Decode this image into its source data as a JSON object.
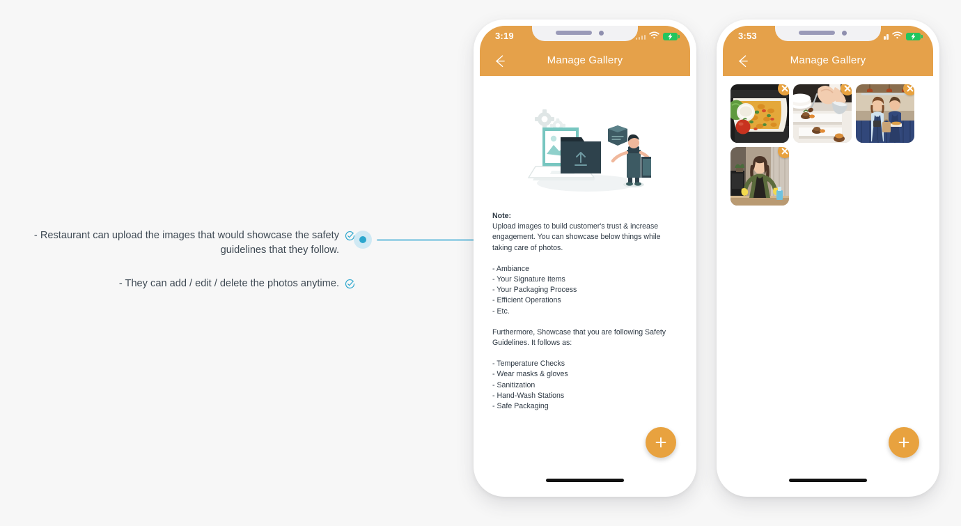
{
  "page": {
    "background_color": "#f7f7f7"
  },
  "annotations": {
    "items": [
      {
        "text": "- Restaurant can upload the images that would showcase the safety\nguidelines that they follow.",
        "icon": "check-circle-icon"
      },
      {
        "text": "- They can add / edit / delete the photos anytime.",
        "icon": "check-circle-icon"
      }
    ],
    "connector": {
      "dot_color": "#2ba6cd",
      "halo_color": "#cfe9f4",
      "line_color": "#9ed3e6"
    },
    "text_color": "#3f4a54",
    "check_color": "#2ba6cd"
  },
  "theme": {
    "accent": "#e5a14a",
    "fab": "#e8a23f",
    "battery": "#22c55e",
    "screen_bg": "#ffffff"
  },
  "phone1": {
    "status": {
      "time": "3:19",
      "signal_icon": "signal-dots-icon",
      "wifi_icon": "wifi-icon",
      "battery_icon": "battery-charging-icon"
    },
    "appbar": {
      "back_icon": "back-arrow-icon",
      "title": "Manage Gallery"
    },
    "illustration": {
      "name": "upload-files-illustration"
    },
    "note": {
      "title": "Note:",
      "paragraph": "Upload images to build customer's trust & increase engagement. You can showcase below things while taking care of photos.",
      "list": [
        "- Ambiance",
        "- Your Signature Items",
        "- Your Packaging Process",
        "- Efficient Operations",
        "- Etc."
      ],
      "paragraph2": "Furthermore, Showcase that you are following Safety Guidelines. It follows as:",
      "list2": [
        "- Temperature Checks",
        "- Wear masks & gloves",
        "- Sanitization",
        "- Hand-Wash Stations",
        "- Safe Packaging"
      ]
    },
    "fab": {
      "icon": "plus-icon",
      "label": "+"
    }
  },
  "phone2": {
    "status": {
      "time": "3:53",
      "signal_icon": "signal-bars-icon",
      "wifi_icon": "wifi-icon",
      "battery_icon": "battery-charging-icon"
    },
    "appbar": {
      "back_icon": "back-arrow-icon",
      "title": "Manage Gallery"
    },
    "gallery": {
      "items": [
        {
          "name": "thumbnail-takeout-pasta-box",
          "delete_icon": "delete-circle-icon"
        },
        {
          "name": "thumbnail-chef-plating-dish",
          "delete_icon": "delete-circle-icon"
        },
        {
          "name": "thumbnail-restaurant-staff-couple",
          "delete_icon": "delete-circle-icon"
        },
        {
          "name": "thumbnail-woman-cleaning-gloves",
          "delete_icon": "delete-circle-icon"
        }
      ]
    },
    "fab": {
      "icon": "plus-icon",
      "label": "+"
    }
  }
}
